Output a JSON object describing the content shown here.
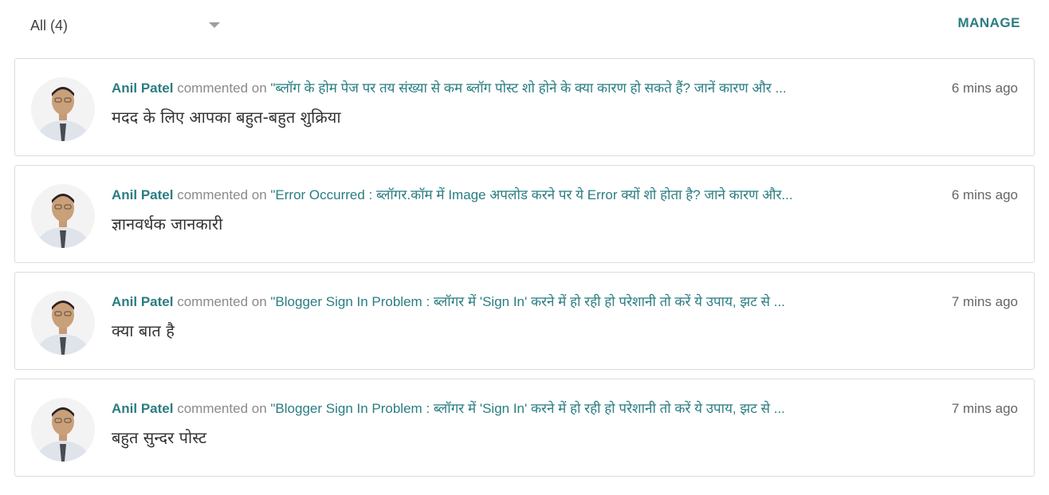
{
  "filter": {
    "label": "All (4)"
  },
  "header": {
    "manage_label": "MANAGE"
  },
  "colors": {
    "accent": "#2b7d82",
    "border": "#dcdcdc",
    "muted": "#8a8a8a"
  },
  "comments": [
    {
      "author": "Anil Patel",
      "verb": "commented on",
      "post": "\"ब्लॉग के होम पेज पर तय संख्या से कम ब्लॉग पोस्ट शो होने के क्या कारण हो सकते हैं? जानें कारण और ...",
      "time": "6 mins ago",
      "text": "मदद के लिए आपका बहुत-बहुत शुक्रिया"
    },
    {
      "author": "Anil Patel",
      "verb": "commented on",
      "post": "\"Error Occurred : ब्लॉगर.कॉम में Image अपलोड करने पर ये Error क्यों शो होता है? जाने कारण और...",
      "time": "6 mins ago",
      "text": "ज्ञानवर्धक जानकारी"
    },
    {
      "author": "Anil Patel",
      "verb": "commented on",
      "post": "\"Blogger Sign In Problem : ब्लॉगर में 'Sign In' करने में हो रही हो परेशानी तो करें ये उपाय, झट से ...",
      "time": "7 mins ago",
      "text": "क्या बात है"
    },
    {
      "author": "Anil Patel",
      "verb": "commented on",
      "post": "\"Blogger Sign In Problem : ब्लॉगर में 'Sign In' करने में हो रही हो परेशानी तो करें ये उपाय, झट से ...",
      "time": "7 mins ago",
      "text": "बहुत सुन्दर पोस्ट"
    }
  ]
}
